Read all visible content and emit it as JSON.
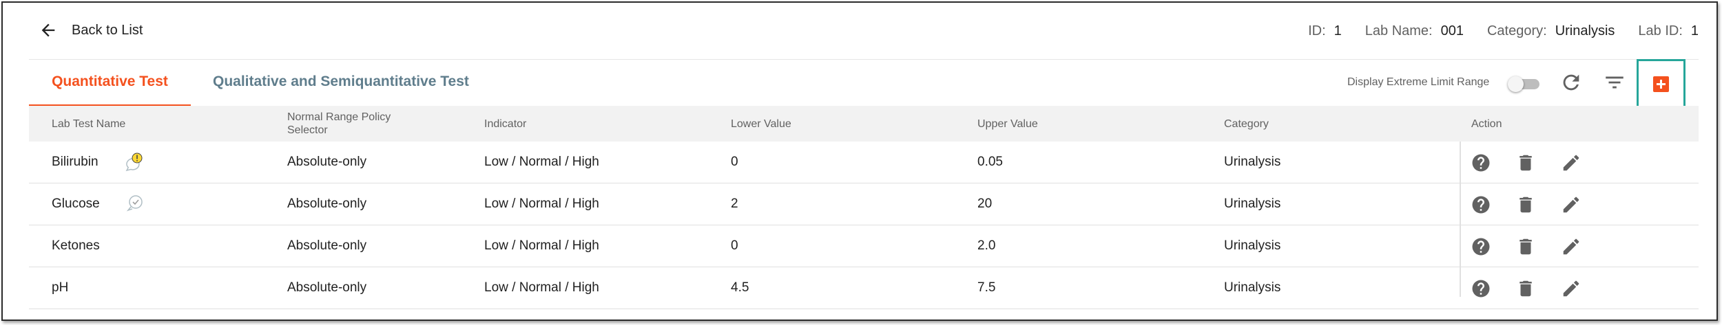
{
  "header": {
    "back_label": "Back to List",
    "meta": [
      {
        "key": "ID:",
        "value": "1"
      },
      {
        "key": "Lab Name:",
        "value": "001"
      },
      {
        "key": "Category:",
        "value": "Urinalysis"
      },
      {
        "key": "Lab ID:",
        "value": "1"
      }
    ]
  },
  "tabs": [
    {
      "label": "Quantitative Test",
      "active": true
    },
    {
      "label": "Qualitative and Semiquantitative Test",
      "active": false
    }
  ],
  "toolbar": {
    "extreme_label": "Display Extreme Limit Range",
    "extreme_on": false,
    "icons": [
      "refresh-icon",
      "filter-icon",
      "add-icon"
    ]
  },
  "table": {
    "columns": [
      "Lab Test Name",
      "Normal Range Policy Selector",
      "Indicator",
      "Lower Value",
      "Upper Value",
      "Category",
      "Action"
    ],
    "rows": [
      {
        "name": "Bilirubin",
        "policy": "Absolute-only",
        "indicator": "Low / Normal / High",
        "lower": "0",
        "upper": "0.05",
        "category": "Urinalysis",
        "status": "warning-comment-icon"
      },
      {
        "name": "Glucose",
        "policy": "Absolute-only",
        "indicator": "Low / Normal / High",
        "lower": "2",
        "upper": "20",
        "category": "Urinalysis",
        "status": "check-comment-icon"
      },
      {
        "name": "Ketones",
        "policy": "Absolute-only",
        "indicator": "Low / Normal / High",
        "lower": "0",
        "upper": "2.0",
        "category": "Urinalysis",
        "status": ""
      },
      {
        "name": "pH",
        "policy": "Absolute-only",
        "indicator": "Low / Normal / High",
        "lower": "4.5",
        "upper": "7.5",
        "category": "Urinalysis",
        "status": ""
      }
    ],
    "actions": [
      "help-icon",
      "delete-icon",
      "edit-icon"
    ]
  },
  "colors": {
    "accent": "#f4511e",
    "tab_inactive": "#5f7d8c",
    "highlight": "#26a69a",
    "icon": "#616161"
  }
}
